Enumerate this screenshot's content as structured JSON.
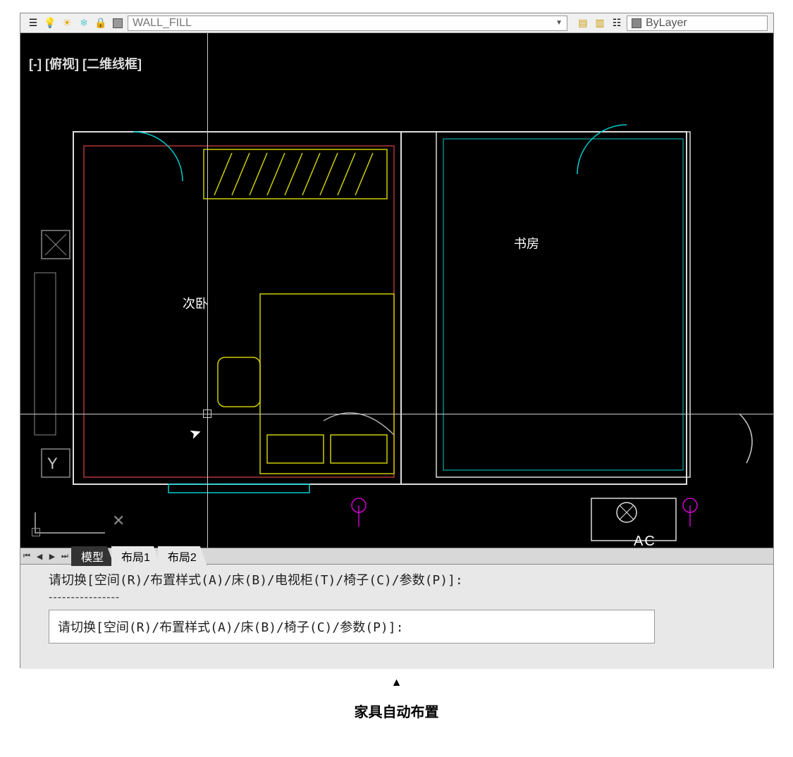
{
  "toolbar": {
    "layer_name": "WALL_FILL",
    "bylayer_label": "ByLayer",
    "icons": {
      "properties": "properties-icon",
      "bulb": "lightbulb-icon",
      "sun": "sun-icon",
      "freeze": "freeze-icon",
      "lock": "lock-icon",
      "color": "color-swatch-icon"
    },
    "layer_icons": [
      "layer-manager-icon",
      "layer-previous-icon",
      "layer-states-icon"
    ]
  },
  "viewport": {
    "label": "[-] [俯视] [二维线框]",
    "rooms": {
      "bedroom": "次卧",
      "study": "书房",
      "ac_unit": "AC"
    }
  },
  "tabs": {
    "nav": [
      "⏮",
      "◀",
      "▶",
      "⏭"
    ],
    "items": [
      {
        "label": "模型",
        "active": true
      },
      {
        "label": "布局1",
        "active": false
      },
      {
        "label": "布局2",
        "active": false
      }
    ]
  },
  "command": {
    "history": "请切换[空间(R)/布置样式(A)/床(B)/电视柜(T)/椅子(C)/参数(P)]:",
    "divider": "----------------",
    "current": "请切换[空间(R)/布置样式(A)/床(B)/椅子(C)/参数(P)]:"
  },
  "caption": {
    "arrow": "▲",
    "text": "家具自动布置"
  },
  "ucs": {
    "x": "✕"
  }
}
